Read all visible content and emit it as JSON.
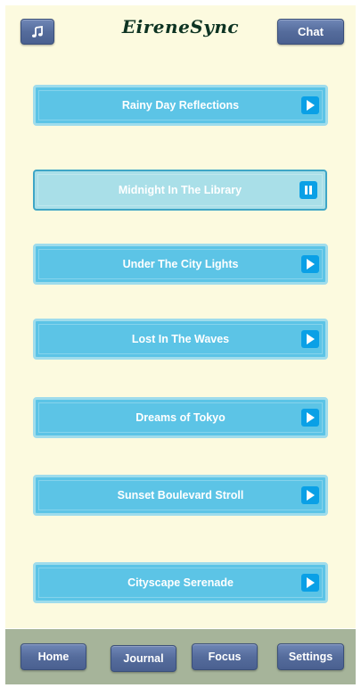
{
  "header": {
    "brand": "EireneSync",
    "music_icon": "music-note-icon",
    "chat_label": "Chat"
  },
  "tracks": [
    {
      "title": "Rainy Day Reflections",
      "state": "play"
    },
    {
      "title": "Midnight In The Library",
      "state": "pause"
    },
    {
      "title": "Under The City Lights",
      "state": "play"
    },
    {
      "title": "Lost In The Waves",
      "state": "play"
    },
    {
      "title": "Dreams of Tokyo",
      "state": "play"
    },
    {
      "title": "Sunset Boulevard Stroll",
      "state": "play"
    },
    {
      "title": "Cityscape Serenade",
      "state": "play"
    }
  ],
  "nav": {
    "home": "Home",
    "journal": "Journal",
    "focus": "Focus",
    "settings": "Settings"
  },
  "colors": {
    "background": "#fcfadf",
    "track": "#5cc4e6",
    "track_active": "#a9dfe8",
    "button": "#556c9c",
    "footer": "#a6b49a",
    "play_button": "#0aa0e6",
    "brand": "#0d3322"
  }
}
